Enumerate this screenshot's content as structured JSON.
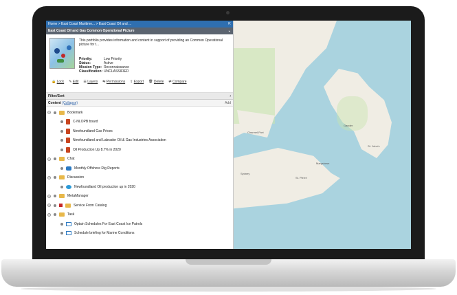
{
  "breadcrumb": "Home > East Coast Maritime... > East Coast Oil and ...",
  "title": "East Coast Oil and Gas Common Operational Picture",
  "description": "This portfolio provides information and content in support of providing an Common Operational picture for t...",
  "fields": [
    {
      "key": "Priority:",
      "value": "Low Priority"
    },
    {
      "key": "Status:",
      "value": "Active"
    },
    {
      "key": "Mission Type:",
      "value": "Reconnaissance"
    },
    {
      "key": "Classification:",
      "value": "UNCLASSIFIED"
    }
  ],
  "actions": [
    "Lock",
    "Edit",
    "Layers",
    "Permissions",
    "Export",
    "Delete",
    "Compare"
  ],
  "filter_label": "Filter/Sort",
  "content_label": "Content",
  "collapse_label": "(Collapse)",
  "add_label": "Add",
  "tree": [
    {
      "label": "Bookmark",
      "level": 1,
      "icon": "folder-icon"
    },
    {
      "label": "C-NLOPB board",
      "level": 2,
      "icon": "document-icon"
    },
    {
      "label": "Newfoundland Gas Prices",
      "level": 2,
      "icon": "document-icon"
    },
    {
      "label": "Newfoundland and Labrador Oil & Gas Industries Association",
      "level": 2,
      "icon": "document-icon"
    },
    {
      "label": "Oil Production Up 8.7% in 2020",
      "level": 2,
      "icon": "document-icon"
    },
    {
      "label": "Chat",
      "level": 1,
      "icon": "folder-icon"
    },
    {
      "label": "Monthly Offshore Rig Reports",
      "level": 2,
      "icon": "chat-icon"
    },
    {
      "label": "Discussion",
      "level": 1,
      "icon": "folder-icon"
    },
    {
      "label": "Newfoundland Oil production up in 2020",
      "level": 2,
      "icon": "discussion-icon"
    },
    {
      "label": "MetaManager",
      "level": 1,
      "icon": "folder-icon"
    },
    {
      "label": "Service From Catalog",
      "level": 1,
      "icon": "folder-icon",
      "checked": true
    },
    {
      "label": "Task",
      "level": 1,
      "icon": "folder-icon"
    },
    {
      "label": "Optain Schedules For East Coast Ice Patrols",
      "level": 2,
      "icon": "task-icon"
    },
    {
      "label": "Schedule briefing for Marine Conditions",
      "level": 2,
      "icon": "task-icon"
    }
  ]
}
